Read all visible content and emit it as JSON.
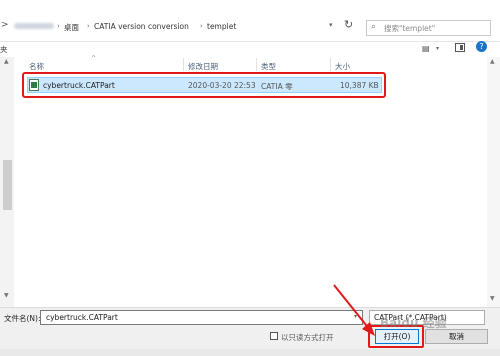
{
  "address_bar": {
    "back_symbol": ">",
    "segments": [
      "桌面",
      "CATIA version conversion",
      "templet"
    ],
    "search_placeholder": "搜索\"templet\""
  },
  "toolbar2": {
    "left_fragment": "夹"
  },
  "columns": {
    "name": "名称",
    "modified": "修改日期",
    "type": "类型",
    "size": "大小"
  },
  "file": {
    "name": "cybertruck.CATPart",
    "modified": "2020-03-20 22:53",
    "type": "CATIA 零",
    "size": "10,387 KB"
  },
  "bottom": {
    "filename_label": "文件名(N):",
    "filename_value": "cybertruck.CATPart",
    "filetype_value": "CATPart (*.CATPart)",
    "readonly_label": "以只读方式打开",
    "open_label": "打开(O)",
    "cancel_label": "取消"
  },
  "watermark": "Baidu 经验",
  "colors": {
    "highlight": "#e11919",
    "selection": "#cce8ff",
    "accent": "#0078d7"
  }
}
